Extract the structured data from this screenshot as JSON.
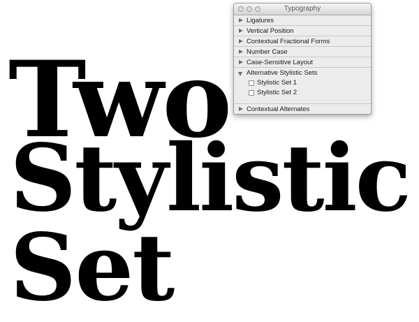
{
  "specimen": {
    "line1": "Two",
    "line2": "Stylistic",
    "line3": "Set"
  },
  "palette": {
    "title": "Typography",
    "window_controls": [
      "close",
      "minimize",
      "zoom"
    ],
    "sections": [
      {
        "label": "Ligatures",
        "expanded": false
      },
      {
        "label": "Vertical Position",
        "expanded": false
      },
      {
        "label": "Contextual Fractional Forms",
        "expanded": false
      },
      {
        "label": "Number Case",
        "expanded": false
      },
      {
        "label": "Case-Sensitive Layout",
        "expanded": false
      },
      {
        "label": "Alternative Stylistic Sets",
        "expanded": true,
        "options": [
          {
            "label": "Stylistic Set 1",
            "checked": false
          },
          {
            "label": "Stylistic Set 2",
            "checked": false
          }
        ]
      },
      {
        "label": "Contextual Alternates",
        "expanded": false
      }
    ]
  },
  "colors": {
    "text": "#000000",
    "panel_bg": "#ececec",
    "disclosure": "#6a6a6a"
  },
  "icons": {
    "collapsed": "disclosure-triangle-right-icon",
    "expanded": "disclosure-triangle-down-icon",
    "option": "checkbox-icon"
  }
}
